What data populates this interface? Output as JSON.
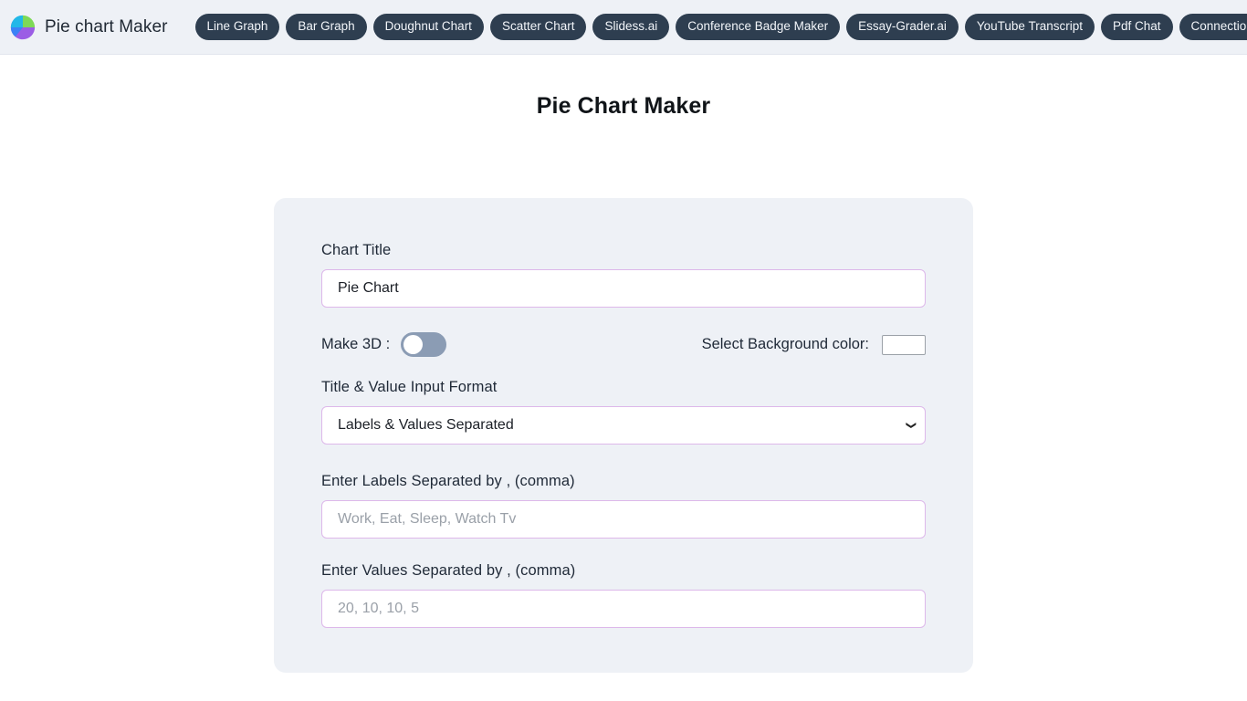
{
  "header": {
    "brand": {
      "name": "Pie chart Maker",
      "logo_icon": "pie-chart-logo-icon",
      "logo_colors": {
        "green": "#7ed957",
        "cyan": "#22b8e8",
        "blue": "#3b82f6",
        "purple": "#9b5de5"
      }
    },
    "nav_items": [
      {
        "label": "Line Graph"
      },
      {
        "label": "Bar Graph"
      },
      {
        "label": "Doughnut Chart"
      },
      {
        "label": "Scatter Chart"
      },
      {
        "label": "Slidess.ai"
      },
      {
        "label": "Conference Badge Maker"
      },
      {
        "label": "Essay-Grader.ai"
      },
      {
        "label": "YouTube Transcript"
      },
      {
        "label": "Pdf Chat"
      },
      {
        "label": "ConnectionsHint.ai"
      }
    ],
    "background_color": "#eef1f6",
    "pill_color": "#2e3e50"
  },
  "page": {
    "title": "Pie Chart Maker"
  },
  "form": {
    "chart_title": {
      "label": "Chart Title",
      "value": "Pie Chart",
      "placeholder": "Chart Title"
    },
    "make_3d": {
      "label": "Make 3D :",
      "state": "off"
    },
    "background_color": {
      "label": "Select Background color:",
      "value": "#ffffff"
    },
    "input_format": {
      "label": "Title & Value Input Format",
      "selected": "Labels & Values Separated",
      "chevron_icon": "chevron-down-icon"
    },
    "labels_field": {
      "label": "Enter Labels Separated by , (comma)",
      "value": "",
      "placeholder": "Work, Eat, Sleep, Watch Tv"
    },
    "values_field": {
      "label": "Enter Values Separated by , (comma)",
      "value": "",
      "placeholder": "20, 10, 10, 5"
    },
    "card_background": "#eef1f6",
    "input_border_color": "#ddb8ea"
  }
}
